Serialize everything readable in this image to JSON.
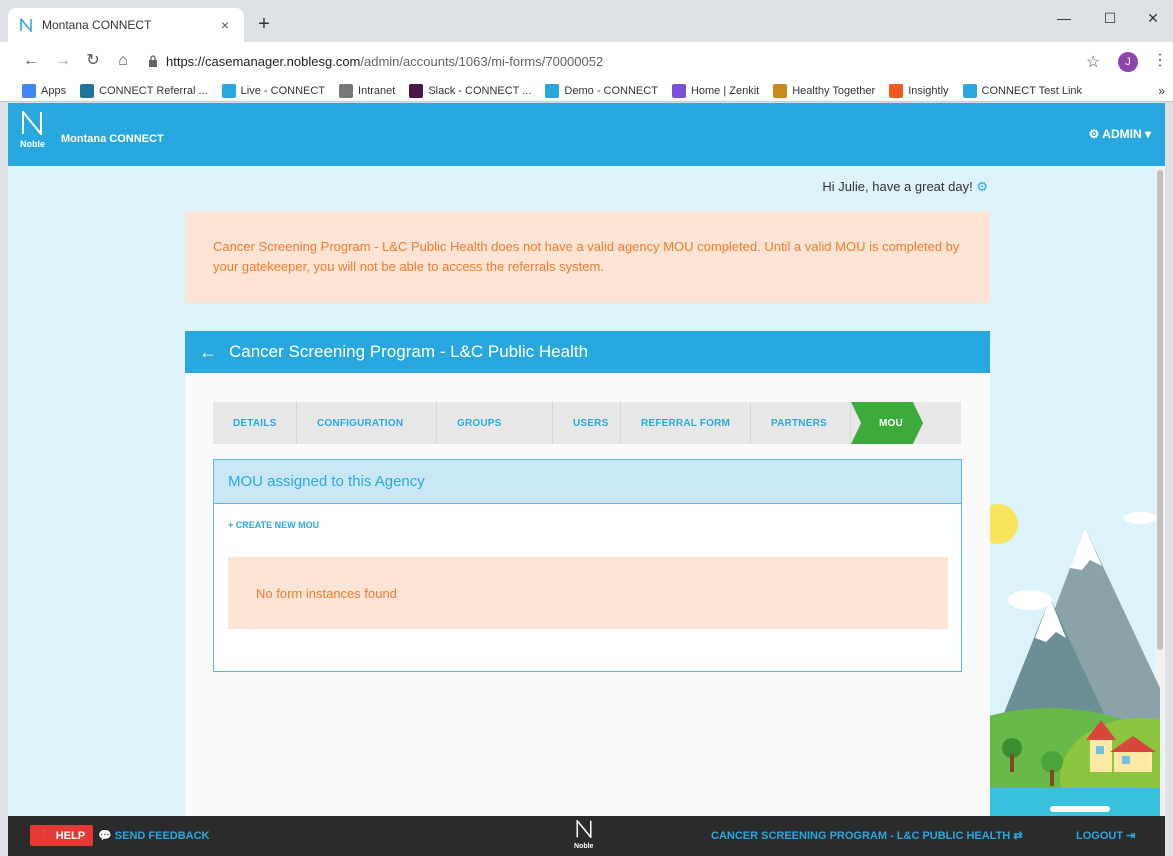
{
  "browser": {
    "tab_title": "Montana CONNECT",
    "tab_close": "×",
    "new_tab": "+",
    "url_host": "https://casemanager.noblesg.com",
    "url_path": "/admin/accounts/1063/mi-forms/70000052",
    "profile_initial": "J",
    "bookmarks": [
      {
        "label": "Apps",
        "icon": "apps-icon",
        "color": "#4285f4"
      },
      {
        "label": "CONNECT Referral ...",
        "icon": "wordpress-icon",
        "color": "#21759b"
      },
      {
        "label": "Live - CONNECT",
        "icon": "noble-icon",
        "color": "#29a8e0"
      },
      {
        "label": "Intranet",
        "icon": "page-icon",
        "color": "#777777"
      },
      {
        "label": "Slack - CONNECT ...",
        "icon": "slack-icon",
        "color": "#4a154b"
      },
      {
        "label": "Demo - CONNECT",
        "icon": "noble-icon",
        "color": "#29a8e0"
      },
      {
        "label": "Home | Zenkit",
        "icon": "zenkit-icon",
        "color": "#7b4fd9"
      },
      {
        "label": "Healthy Together",
        "icon": "healthy-icon",
        "color": "#c98a1b"
      },
      {
        "label": "Insightly",
        "icon": "insightly-icon",
        "color": "#f15a24"
      },
      {
        "label": "CONNECT Test Link",
        "icon": "noble-icon",
        "color": "#29a8e0"
      }
    ],
    "bookmarks_more": "»"
  },
  "header": {
    "logo_text": "Noble",
    "app_name": "Montana CONNECT",
    "admin_label": "ADMIN"
  },
  "greeting": "Hi Julie, have a great day!",
  "alert_text": "Cancer Screening Program - L&C Public Health does not have a valid agency MOU completed. Until a valid MOU is completed by your gatekeeper, you will not be able to access the referrals system.",
  "card": {
    "title": "Cancer Screening Program - L&C Public Health",
    "steps": [
      {
        "label": "DETAILS",
        "active": false
      },
      {
        "label": "CONFIGURATION",
        "active": false
      },
      {
        "label": "GROUPS",
        "active": false
      },
      {
        "label": "USERS",
        "active": false
      },
      {
        "label": "REFERRAL FORM",
        "active": false
      },
      {
        "label": "PARTNERS",
        "active": false
      },
      {
        "label": "MOU",
        "active": true
      }
    ],
    "panel_title": "MOU assigned to this Agency",
    "create_link": "+ CREATE NEW MOU",
    "empty_message": "No form instances found"
  },
  "footer": {
    "help": "HELP",
    "feedback": "SEND FEEDBACK",
    "logo_text": "Noble",
    "agency": "CANCER SCREENING PROGRAM - L&C PUBLIC HEALTH",
    "logout": "LOGOUT"
  },
  "colors": {
    "brand_blue": "#29a8e0",
    "active_step": "#3cab3c",
    "alert_bg": "#fde4d4",
    "alert_text": "#f07b2f",
    "help_red": "#e53935"
  }
}
